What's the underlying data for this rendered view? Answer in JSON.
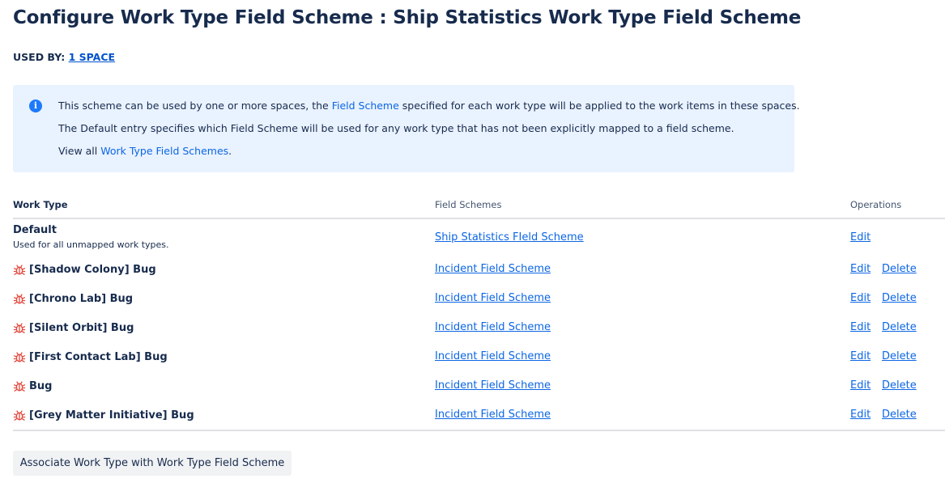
{
  "page": {
    "title": "Configure Work Type Field Scheme : Ship Statistics Work Type Field Scheme",
    "used_by_label": "USED BY:",
    "used_by_link": "1 SPACE"
  },
  "info": {
    "icon": "info-icon",
    "line1_pre": "This scheme can be used by one or more spaces, the ",
    "line1_link": "Field Scheme",
    "line1_post": " specified for each work type will be applied to the work items in these spaces.",
    "line2": "The Default entry specifies which Field Scheme will be used for any work type that has not been explicitly mapped to a field scheme.",
    "line3_pre": "View all ",
    "line3_link": "Work Type Field Schemes",
    "line3_post": "."
  },
  "table": {
    "headers": {
      "work_type": "Work Type",
      "field_schemes": "Field Schemes",
      "operations": "Operations"
    },
    "default_row": {
      "name": "Default",
      "description": "Used for all unmapped work types.",
      "scheme": "Ship Statistics FIeld Scheme",
      "edit": "Edit"
    },
    "rows": [
      {
        "name": "[Shadow Colony] Bug",
        "scheme": "Incident Field Scheme",
        "edit": "Edit",
        "delete": "Delete"
      },
      {
        "name": "[Chrono Lab] Bug",
        "scheme": "Incident Field Scheme",
        "edit": "Edit",
        "delete": "Delete"
      },
      {
        "name": "[Silent Orbit] Bug",
        "scheme": "Incident Field Scheme",
        "edit": "Edit",
        "delete": "Delete"
      },
      {
        "name": "[First Contact Lab] Bug",
        "scheme": "Incident Field Scheme",
        "edit": "Edit",
        "delete": "Delete"
      },
      {
        "name": "Bug",
        "scheme": "Incident Field Scheme",
        "edit": "Edit",
        "delete": "Delete"
      },
      {
        "name": "[Grey Matter Initiative] Bug",
        "scheme": "Incident Field Scheme",
        "edit": "Edit",
        "delete": "Delete"
      }
    ]
  },
  "actions": {
    "associate_button": "Associate Work Type with Work Type Field Scheme"
  },
  "colors": {
    "link": "#0c66e4",
    "bug_icon": "#e2483d",
    "info_bg": "#e9f2ff"
  }
}
